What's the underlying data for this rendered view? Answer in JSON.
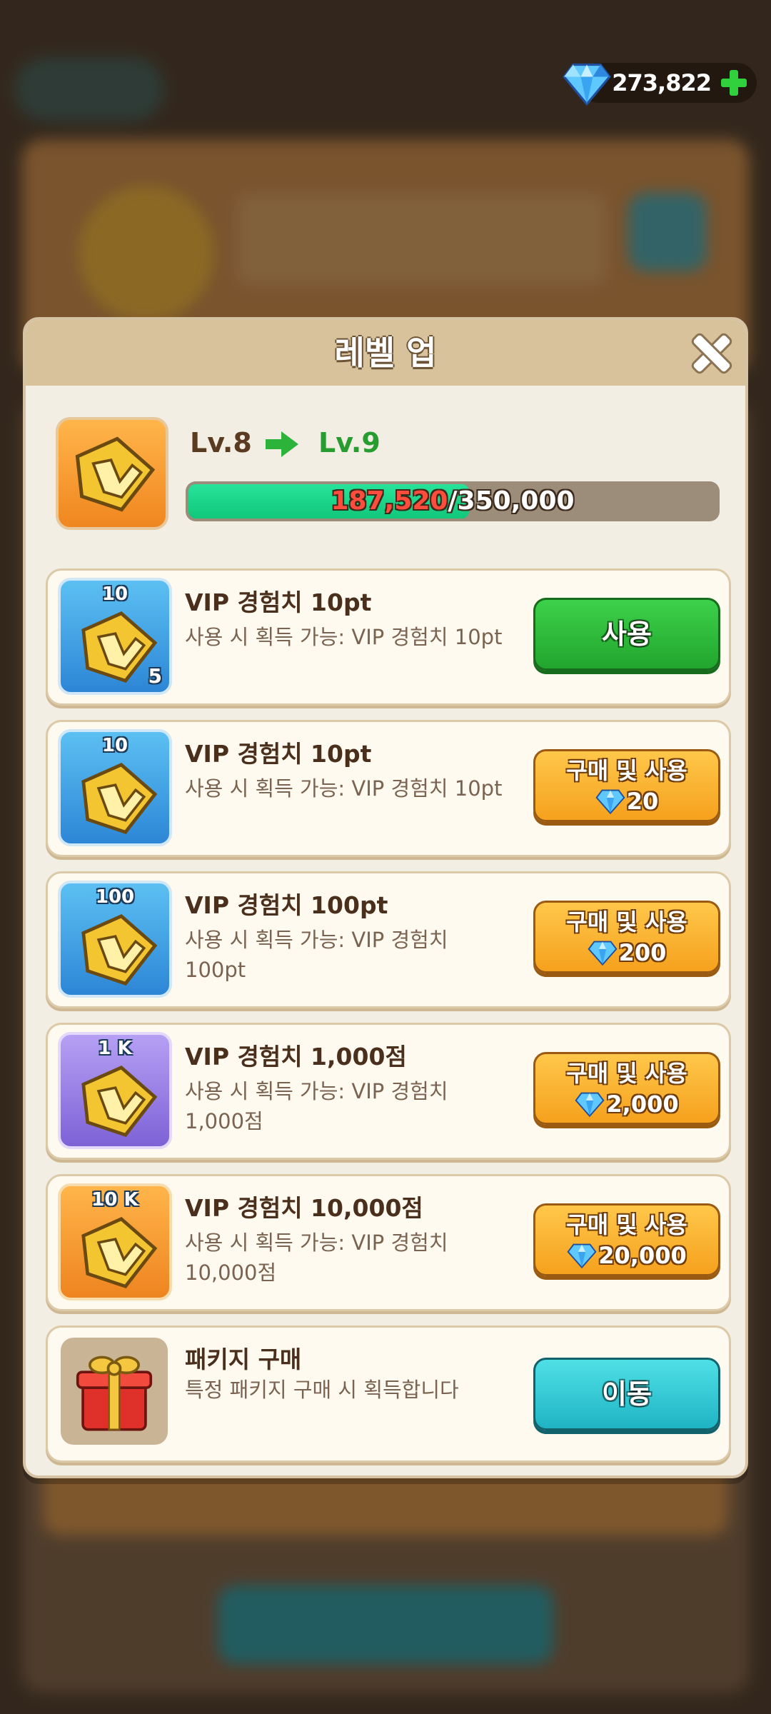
{
  "currency": {
    "diamonds": "273,822"
  },
  "modal": {
    "title": "레벨 업"
  },
  "level": {
    "current": "Lv.8",
    "next": "Lv.9",
    "progress_current": "187,520",
    "progress_max": "/350,000",
    "progress_fraction": 0.536
  },
  "items": [
    {
      "icon_label": "10",
      "count": "5",
      "title": "VIP 경험치 10pt",
      "desc": "사용 시 획득 가능: VIP 경험치 10pt",
      "button": "사용"
    },
    {
      "icon_label": "10",
      "title": "VIP 경험치 10pt",
      "desc": "사용 시 획득 가능: VIP 경험치 10pt",
      "button": "구매 및 사용",
      "price": "20"
    },
    {
      "icon_label": "100",
      "title": "VIP 경험치 100pt",
      "desc": "사용 시 획득 가능: VIP 경험치 100pt",
      "button": "구매 및 사용",
      "price": "200"
    },
    {
      "icon_label": "1 K",
      "title": "VIP 경험치 1,000점",
      "desc": "사용 시 획득 가능: VIP 경험치 1,000점",
      "button": "구매 및 사용",
      "price": "2,000"
    },
    {
      "icon_label": "10 K",
      "title": "VIP 경험치 10,000점",
      "desc": "사용 시 획득 가능: VIP 경험치 10,000점",
      "button": "구매 및 사용",
      "price": "20,000"
    },
    {
      "title": "패키지 구매",
      "desc": "특정 패키지 구매 시 획득합니다",
      "button": "이동"
    }
  ],
  "colors": {
    "header": "#d8c29c",
    "panel": "#f2eee4",
    "green_button": "#22a52d",
    "orange_button": "#f5a11d",
    "teal_button": "#1fb4c4",
    "progress_fill": "#11c77a",
    "level_next": "#279c2f"
  },
  "icons": [
    "diamond-icon",
    "plus-icon",
    "close-icon",
    "arrow-right-icon",
    "vip-exp-icon",
    "gift-box-icon"
  ]
}
